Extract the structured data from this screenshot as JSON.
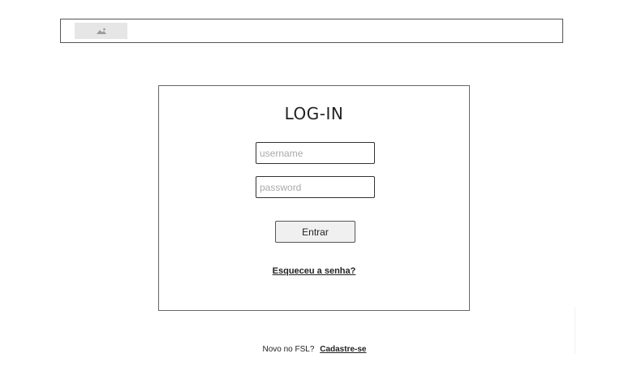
{
  "header": {
    "logo_icon": "image-placeholder-icon"
  },
  "login": {
    "title": "LOG-IN",
    "username_placeholder": "username",
    "password_placeholder": "password",
    "submit_label": "Entrar",
    "forgot_label": "Esqueceu a senha?"
  },
  "signup": {
    "prompt": "Novo no FSL?",
    "link_label": "Cadastre-se"
  },
  "colors": {
    "border": "#555555",
    "button_bg": "#f0f0f0",
    "logo_bg": "#e6e6e6"
  }
}
